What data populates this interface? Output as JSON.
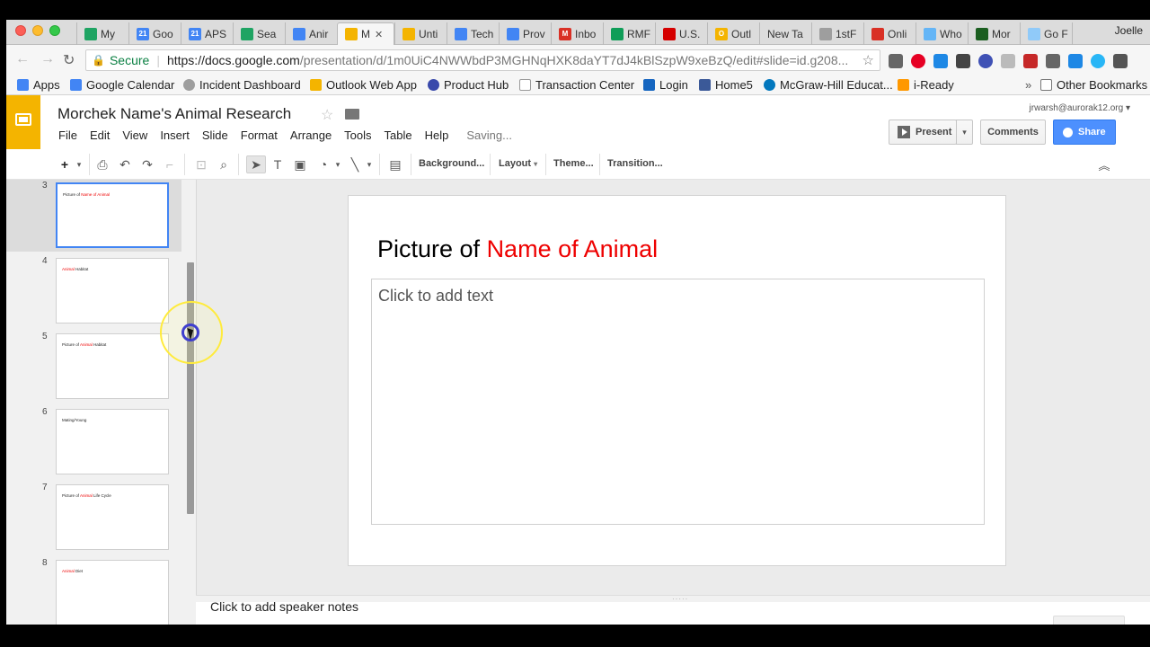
{
  "browser": {
    "tabs": [
      {
        "label": "My",
        "color": "#1fa463"
      },
      {
        "label": "Goo",
        "color": "#4285f4"
      },
      {
        "label": "APS",
        "color": "#4285f4"
      },
      {
        "label": "Sea",
        "color": "#1fa463"
      },
      {
        "label": "Anir",
        "color": "#4285f4"
      },
      {
        "label": "M",
        "color": "#f4b400"
      },
      {
        "label": "Unti",
        "color": "#f4b400"
      },
      {
        "label": "Tech",
        "color": "#4285f4"
      },
      {
        "label": "Prov",
        "color": "#4285f4"
      },
      {
        "label": "Inbo",
        "color": "#d93025"
      },
      {
        "label": "RMF",
        "color": "#0f9d58"
      },
      {
        "label": "U.S.",
        "color": "#d50000"
      },
      {
        "label": "Outl",
        "color": "#f4b400"
      },
      {
        "label": "New Ta",
        "color": ""
      },
      {
        "label": "1stF",
        "color": "#9e9e9e"
      },
      {
        "label": "Onli",
        "color": "#d93025"
      },
      {
        "label": "Who",
        "color": "#64b5f6"
      },
      {
        "label": "Mor",
        "color": "#1b5e20"
      },
      {
        "label": "Go F",
        "color": "#90caf9"
      }
    ],
    "profile_name": "Joelle",
    "secure_label": "Secure",
    "url_host": "https://docs.google.com",
    "url_path": "/presentation/d/1m0UiC4NWWbdP3MGHNqHXK8daYT7dJ4kBlSzpW9xeBzQ/edit#slide=id.g208...",
    "bookmarks": [
      {
        "label": "Apps",
        "color": "#4285f4"
      },
      {
        "label": "Google Calendar",
        "color": "#4285f4"
      },
      {
        "label": "Incident Dashboard",
        "color": "#9e9e9e"
      },
      {
        "label": "Outlook Web App",
        "color": "#f4b400"
      },
      {
        "label": "Product Hub",
        "color": "#3949ab"
      },
      {
        "label": "Transaction Center",
        "color": "#bdbdbd"
      },
      {
        "label": "Login",
        "color": "#1565c0"
      },
      {
        "label": "Home5",
        "color": "#3b5998"
      },
      {
        "label": "McGraw-Hill Educat...",
        "color": "#0277bd"
      },
      {
        "label": "i-Ready",
        "color": "#ff9800"
      }
    ],
    "other_bookmarks": "Other Bookmarks"
  },
  "app": {
    "title": "Morchek Name's Animal Research",
    "account": "jrwarsh@aurorak12.org",
    "menu": [
      "File",
      "Edit",
      "View",
      "Insert",
      "Slide",
      "Format",
      "Arrange",
      "Tools",
      "Table",
      "Help"
    ],
    "status": "Saving...",
    "present_label": "Present",
    "comments_label": "Comments",
    "share_label": "Share",
    "brand_color": "#f4b400",
    "share_color": "#4d90fe"
  },
  "toolbar": {
    "background_label": "Background...",
    "layout_label": "Layout",
    "theme_label": "Theme...",
    "transition_label": "Transition..."
  },
  "filmstrip": {
    "slides": [
      {
        "number": "3",
        "prefix": "Picture of ",
        "highlight": "Name of Animal",
        "suffix": ""
      },
      {
        "number": "4",
        "prefix": "",
        "highlight": "Animal",
        "suffix": " Habitat"
      },
      {
        "number": "5",
        "prefix": "Picture of ",
        "highlight": "Animal",
        "suffix": " Habitat"
      },
      {
        "number": "6",
        "prefix": "Mating/Young",
        "highlight": "",
        "suffix": ""
      },
      {
        "number": "7",
        "prefix": "Picture of ",
        "highlight": "Animal",
        "suffix": " Life Cycle"
      },
      {
        "number": "8",
        "prefix": "",
        "highlight": "Animal",
        "suffix": " Diet"
      }
    ]
  },
  "slide": {
    "title_prefix": "Picture of ",
    "title_highlight": "Name of Animal",
    "highlight_color": "#ee0000",
    "body_placeholder": "Click to add text"
  },
  "notes": {
    "placeholder": "Click to add speaker notes"
  }
}
